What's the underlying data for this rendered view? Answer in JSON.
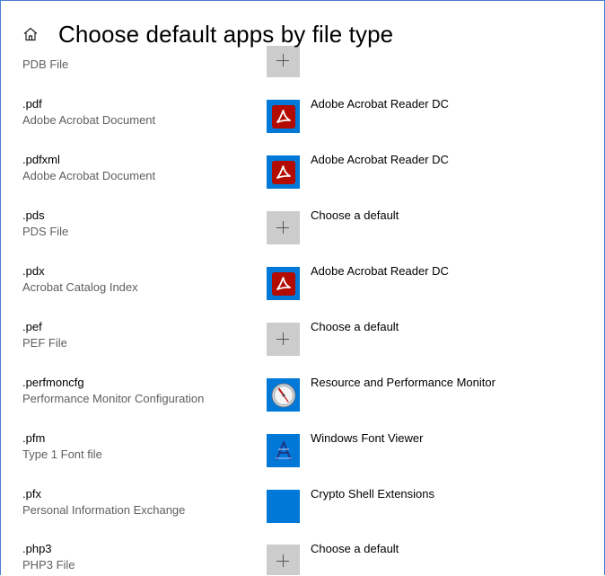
{
  "header": {
    "title": "Choose default apps by file type",
    "home_icon": "home-icon"
  },
  "colors": {
    "accent": "#0078d7",
    "window_border": "#4a7fd4",
    "plus_tile": "#cccccc",
    "acrobat_red": "#b30b00"
  },
  "rows": [
    {
      "ext": "",
      "desc": "PDB File",
      "app": "",
      "icon": "plus-icon"
    },
    {
      "ext": ".pdf",
      "desc": "Adobe Acrobat Document",
      "app": "Adobe Acrobat Reader DC",
      "icon": "acrobat-icon"
    },
    {
      "ext": ".pdfxml",
      "desc": "Adobe Acrobat Document",
      "app": "Adobe Acrobat Reader DC",
      "icon": "acrobat-icon"
    },
    {
      "ext": ".pds",
      "desc": "PDS File",
      "app": "Choose a default",
      "icon": "plus-icon"
    },
    {
      "ext": ".pdx",
      "desc": "Acrobat Catalog Index",
      "app": "Adobe Acrobat Reader DC",
      "icon": "acrobat-icon"
    },
    {
      "ext": ".pef",
      "desc": "PEF File",
      "app": "Choose a default",
      "icon": "plus-icon"
    },
    {
      "ext": ".perfmoncfg",
      "desc": "Performance Monitor Configuration",
      "app": "Resource and Performance Monitor",
      "icon": "resource-monitor-icon"
    },
    {
      "ext": ".pfm",
      "desc": "Type 1 Font file",
      "app": "Windows Font Viewer",
      "icon": "font-viewer-icon"
    },
    {
      "ext": ".pfx",
      "desc": "Personal Information Exchange",
      "app": "Crypto Shell Extensions",
      "icon": "crypto-shell-icon"
    },
    {
      "ext": ".php3",
      "desc": "PHP3 File",
      "app": "Choose a default",
      "icon": "plus-icon"
    }
  ]
}
